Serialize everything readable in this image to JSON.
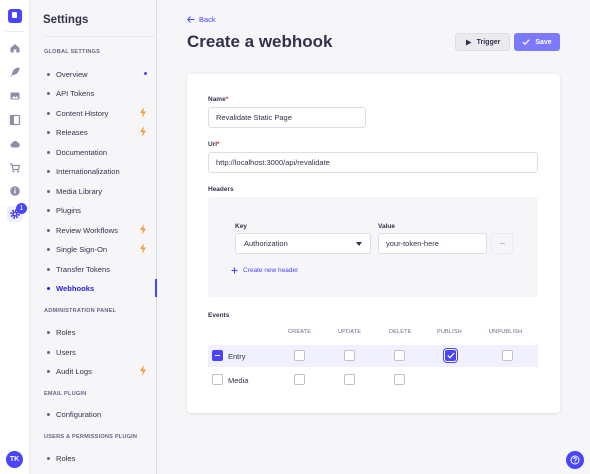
{
  "rail": {
    "icons": [
      "strapi-logo-icon",
      "home-icon",
      "feather-icon",
      "image-icon",
      "layout-icon",
      "cloud-icon",
      "cart-icon",
      "info-icon",
      "gear-icon"
    ],
    "notification_count": "1",
    "avatar_initials": "TK"
  },
  "subnav": {
    "title": "Settings",
    "sections": [
      {
        "label": "GLOBAL SETTINGS",
        "items": [
          {
            "label": "Overview",
            "marker": "dot"
          },
          {
            "label": "API Tokens"
          },
          {
            "label": "Content History",
            "marker": "bolt"
          },
          {
            "label": "Releases",
            "marker": "bolt"
          },
          {
            "label": "Documentation"
          },
          {
            "label": "Internationalization"
          },
          {
            "label": "Media Library"
          },
          {
            "label": "Plugins"
          },
          {
            "label": "Review Workflows",
            "marker": "bolt"
          },
          {
            "label": "Single Sign-On",
            "marker": "bolt"
          },
          {
            "label": "Transfer Tokens"
          },
          {
            "label": "Webhooks",
            "active": true
          }
        ]
      },
      {
        "label": "ADMINISTRATION PANEL",
        "items": [
          {
            "label": "Roles"
          },
          {
            "label": "Users"
          },
          {
            "label": "Audit Logs",
            "marker": "bolt"
          }
        ]
      },
      {
        "label": "EMAIL PLUGIN",
        "items": [
          {
            "label": "Configuration"
          }
        ]
      },
      {
        "label": "USERS & PERMISSIONS PLUGIN",
        "items": [
          {
            "label": "Roles"
          }
        ]
      }
    ]
  },
  "header": {
    "back_label": "Back",
    "title": "Create a webhook",
    "trigger_label": "Trigger",
    "save_label": "Save"
  },
  "form": {
    "name_label": "Name",
    "name_value": "Revalidate Static Page",
    "url_label": "Url",
    "url_value": "http://localhost:3000/api/revalidate",
    "headers_label": "Headers",
    "key_label": "Key",
    "value_label": "Value",
    "key_value": "Authorization",
    "value_value": "your-token-here",
    "add_header_label": "Create new header",
    "events_label": "Events",
    "event_columns": [
      "CREATE",
      "UPDATE",
      "DELETE",
      "PUBLISH",
      "UNPUBLISH"
    ],
    "events": [
      {
        "name": "Entry",
        "row_state": "indeterminate",
        "checks": [
          false,
          false,
          false,
          true,
          false
        ]
      },
      {
        "name": "Media",
        "row_state": "unchecked",
        "checks": [
          false,
          false,
          false
        ]
      }
    ]
  },
  "colors": {
    "primary": "#4945ff",
    "primary_light": "#7b79ff",
    "warning_bolt": "#f29d41",
    "required": "#d02b20"
  }
}
